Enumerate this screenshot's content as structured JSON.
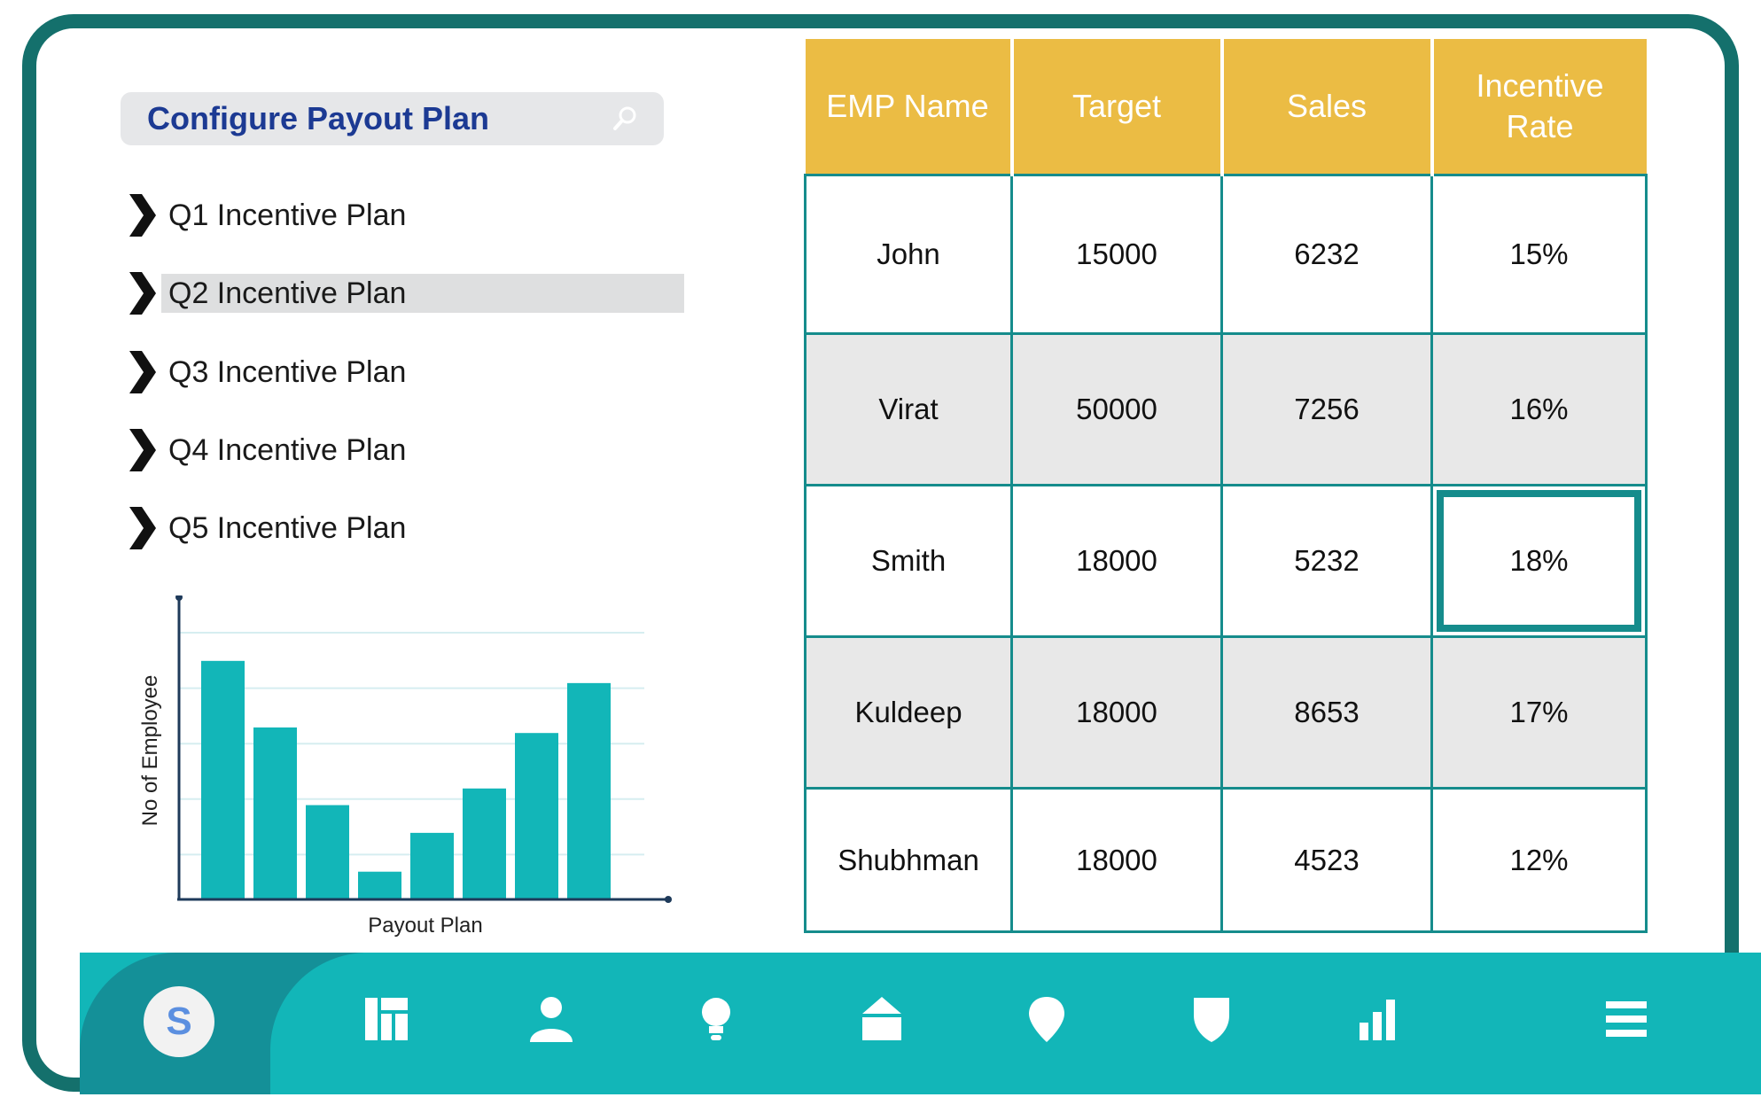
{
  "search": {
    "title": "Configure Payout Plan",
    "icon": "search-icon"
  },
  "menu": [
    {
      "label": "Q1 Incentive Plan",
      "selected": false
    },
    {
      "label": "Q2 Incentive Plan",
      "selected": true
    },
    {
      "label": "Q3 Incentive Plan",
      "selected": false
    },
    {
      "label": "Q4 Incentive Plan",
      "selected": false
    },
    {
      "label": "Q5 Incentive Plan",
      "selected": false
    }
  ],
  "chart_data": {
    "type": "bar",
    "xlabel": "Payout Plan",
    "ylabel": "No of Employee",
    "values": [
      4.3,
      3.1,
      1.7,
      0.5,
      1.2,
      2.0,
      3.0,
      3.9
    ],
    "ylim": [
      0,
      5
    ],
    "grid": true,
    "color": "#12b6b8"
  },
  "table": {
    "headers": [
      "EMP Name",
      "Target",
      "Sales",
      "Incentive Rate"
    ],
    "rows": [
      [
        "John",
        "15000",
        "6232",
        "15%"
      ],
      [
        "Virat",
        "50000",
        "7256",
        "16%"
      ],
      [
        "Smith",
        "18000",
        "5232",
        "18%"
      ],
      [
        "Kuldeep",
        "18000",
        "8653",
        "17%"
      ],
      [
        "Shubhman",
        "18000",
        "4523",
        "12%"
      ]
    ],
    "highlighted_cell": {
      "row": 2,
      "col": 3
    }
  },
  "nav": {
    "avatar_letter": "S",
    "icons": [
      "dashboard-icon",
      "user-icon",
      "lightbulb-icon",
      "home-icon",
      "location-pin-icon",
      "shield-icon",
      "bar-chart-icon",
      "hamburger-menu-icon"
    ]
  },
  "colors": {
    "frame": "#14706c",
    "accent": "#12b6b8",
    "header": "#ebbc44",
    "title": "#1c3a93"
  }
}
